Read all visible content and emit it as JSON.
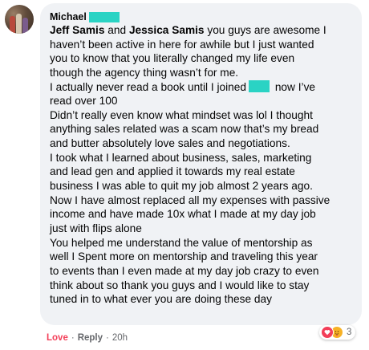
{
  "comment": {
    "author": "Michael",
    "lines": [
      {
        "mention1": "Jeff Samis",
        "text1": " and ",
        "mention2": "Jessica Samis",
        "text2": " you guys are awesome I"
      },
      "haven’t been active in here for awhile but I just wanted",
      "you to know that you literally changed my life even",
      "though the agency thing wasn’t for me.",
      {
        "before": "I actually never read a book until I joined",
        "after": " now I’ve"
      },
      "read over 100",
      "Didn’t really even know what mindset was lol I thought",
      "anything sales related was a scam now that’s my bread",
      "and butter absolutely love sales and negotiations.",
      "I took what I learned about business, sales, marketing",
      "and lead gen and applied it towards my real estate",
      "business I was able to quit my job almost 2 years ago.",
      "Now I have almost replaced all my expenses with passive",
      "income and have made 10x what I made at my day job",
      "just with flips alone",
      "You helped me understand the value of mentorship as",
      "well I Spent more on mentorship and traveling this year",
      "to events than I even made at my day job crazy to even",
      "think about so thank you guys and I would like to stay",
      "tuned in to what ever you are doing these day"
    ]
  },
  "reactions": {
    "icons": [
      "love-reaction",
      "care-reaction"
    ],
    "count": "3"
  },
  "actions": {
    "love": "Love",
    "separator": "·",
    "reply": "Reply",
    "time": "20h"
  },
  "colors": {
    "bubble": "#f0f2f5",
    "redaction": "#2ad3c4",
    "love": "#f33e58"
  }
}
